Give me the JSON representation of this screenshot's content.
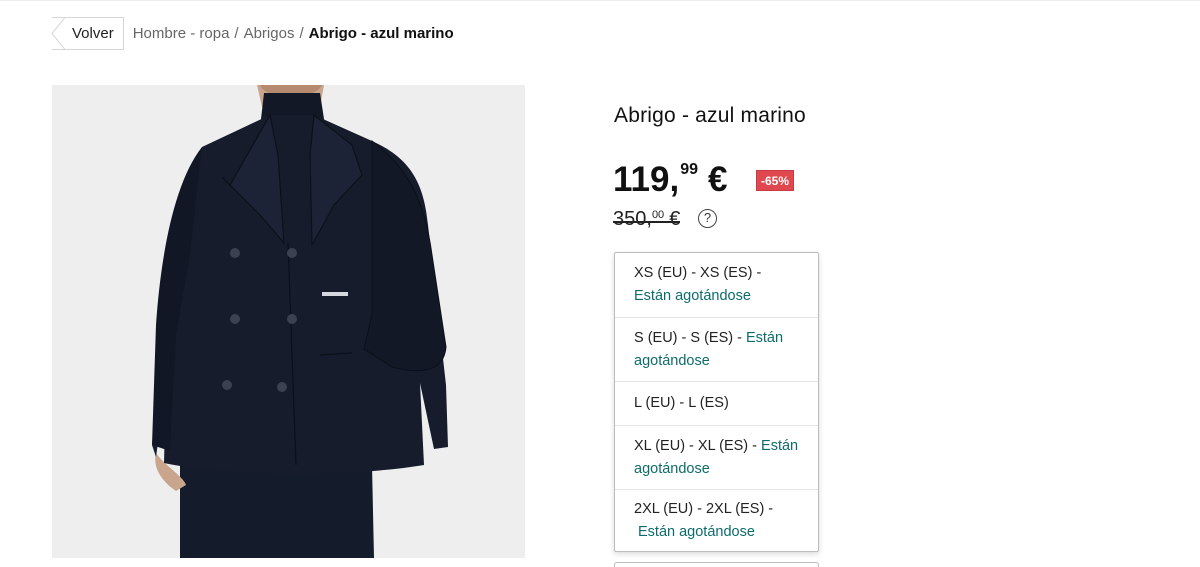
{
  "breadcrumb": {
    "back_label": "Volver",
    "items": [
      "Hombre - ropa",
      "Abrigos"
    ],
    "separator": "/",
    "current": "Abrigo - azul marino"
  },
  "product": {
    "title": "Abrigo - azul marino",
    "price": {
      "integer": "119,",
      "decimals": "99",
      "currency": "€"
    },
    "discount_badge": "-65%",
    "old_price": {
      "integer": "350,",
      "decimals": "00",
      "currency": "€"
    },
    "help_glyph": "?"
  },
  "sizes": [
    {
      "label": "XS (EU) - XS (ES) -",
      "stock": "Están agotándose"
    },
    {
      "label": "S (EU) - S (ES) -",
      "stock": "Están agotándose"
    },
    {
      "label": "L (EU) - L (ES)",
      "stock": ""
    },
    {
      "label": "XL (EU) - XL (ES) -",
      "stock": "Están agotándose"
    },
    {
      "label": "2XL (EU) - 2XL (ES) -",
      "stock": "Están agotándose"
    }
  ],
  "colors": {
    "discount_bg": "#e0484f",
    "stock_text": "#0e6b6b",
    "image_bg": "#eeeeef",
    "coat": "#161c2c"
  },
  "icons": {
    "back": "chevron-left-icon",
    "help": "question-circle-icon"
  }
}
